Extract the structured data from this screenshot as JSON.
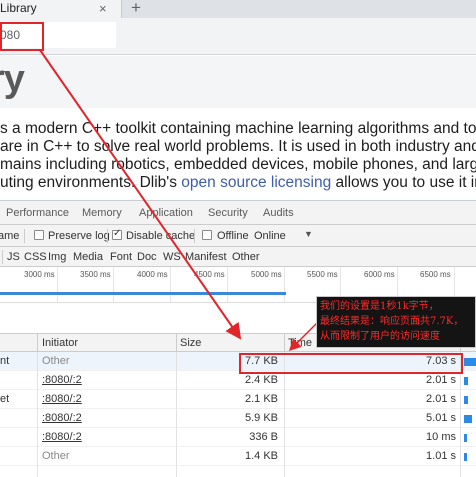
{
  "browser": {
    "tab_title": "Library",
    "tab_close": "×",
    "new_tab": "+",
    "url": "080"
  },
  "page": {
    "heading": "rary",
    "para_lines": [
      {
        "pre": "s a modern C++ toolkit containing machine learning algorithms and too",
        "link": "",
        "post": ""
      },
      {
        "pre": "are in C++ to solve real world problems. It is used in both industry and",
        "link": "",
        "post": ""
      },
      {
        "pre": "mains including robotics, embedded devices, mobile phones, and large",
        "link": "",
        "post": ""
      },
      {
        "pre": "uting environments. Dlib's ",
        "link": "open source licensing",
        "post": " allows you to use it in"
      }
    ]
  },
  "devtools": {
    "tabs": [
      "Performance",
      "Memory",
      "Application",
      "Security",
      "Audits"
    ],
    "toolbar": {
      "left_fragment": "ame",
      "preserve_log": "Preserve log",
      "disable_cache": "Disable cache",
      "offline": "Offline",
      "throttle": "Online",
      "throttle_arrow": "▼"
    },
    "filters": [
      "JS",
      "CSS",
      "Img",
      "Media",
      "Font",
      "Doc",
      "WS",
      "Manifest",
      "Other"
    ],
    "ticks": [
      "3000 ms",
      "3500 ms",
      "4000 ms",
      "4500 ms",
      "5000 ms",
      "5500 ms",
      "6000 ms",
      "6500 ms"
    ],
    "columns": [
      "Initiator",
      "Size",
      "Time"
    ],
    "rows": [
      {
        "name": "nt",
        "initiator": "Other",
        "size": "7.7 KB",
        "time": "7.03 s",
        "selected": true,
        "wf": 1.0
      },
      {
        "name": "",
        "initiator": ":8080/:2",
        "size": "2.4 KB",
        "time": "2.01 s",
        "selected": false,
        "wf": 0.3
      },
      {
        "name": "et",
        "initiator": ":8080/:2",
        "size": "2.1 KB",
        "time": "2.01 s",
        "selected": false,
        "wf": 0.3
      },
      {
        "name": "",
        "initiator": ":8080/:2",
        "size": "5.9 KB",
        "time": "5.01 s",
        "selected": false,
        "wf": 0.7
      },
      {
        "name": "",
        "initiator": ":8080/:2",
        "size": "336 B",
        "time": "10 ms",
        "selected": false,
        "wf": 0.1
      },
      {
        "name": "",
        "initiator": "Other",
        "size": "1.4 KB",
        "time": "1.01 s",
        "selected": false,
        "wf": 0.15
      }
    ]
  },
  "annotation": {
    "lines": [
      "我们的设置是1秒1k字节，",
      "最终结果是：响应页面共7.7K，",
      "从而限制了用户的访问速度"
    ]
  },
  "colors": {
    "annotation_red": "#e0252b",
    "waterfall_blue": "#2b8ae6",
    "link_blue": "#3d5eab"
  }
}
